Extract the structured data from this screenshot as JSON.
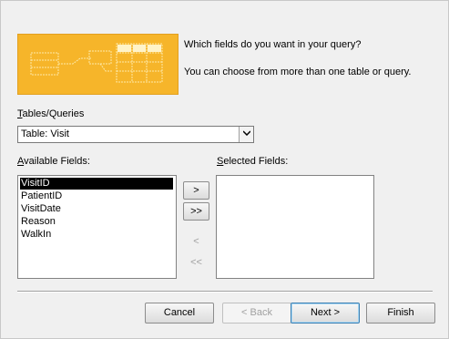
{
  "prompt": {
    "line1": "Which fields do you want in your query?",
    "line2": "You can choose from more than one table or query."
  },
  "tables_queries": {
    "label_accel": "T",
    "label_rest": "ables/Queries",
    "selected": "Table: Visit",
    "dropdown_icon": "chevron-down-icon"
  },
  "available_fields": {
    "label_accel": "A",
    "label_rest": "vailable Fields:",
    "items": [
      "VisitID",
      "PatientID",
      "VisitDate",
      "Reason",
      "WalkIn"
    ],
    "selected_index": 0
  },
  "selected_fields": {
    "label_pre": "",
    "label_accel": "S",
    "label_rest": "elected Fields:",
    "items": []
  },
  "move_buttons": {
    "add_one": ">",
    "add_all": ">>",
    "remove_one": "<",
    "remove_all": "<<"
  },
  "footer": {
    "cancel": "Cancel",
    "back": "< Back",
    "next": "Next >",
    "finish": "Finish"
  },
  "colors": {
    "illustration": "#f6b52a",
    "selection": "#000000"
  }
}
